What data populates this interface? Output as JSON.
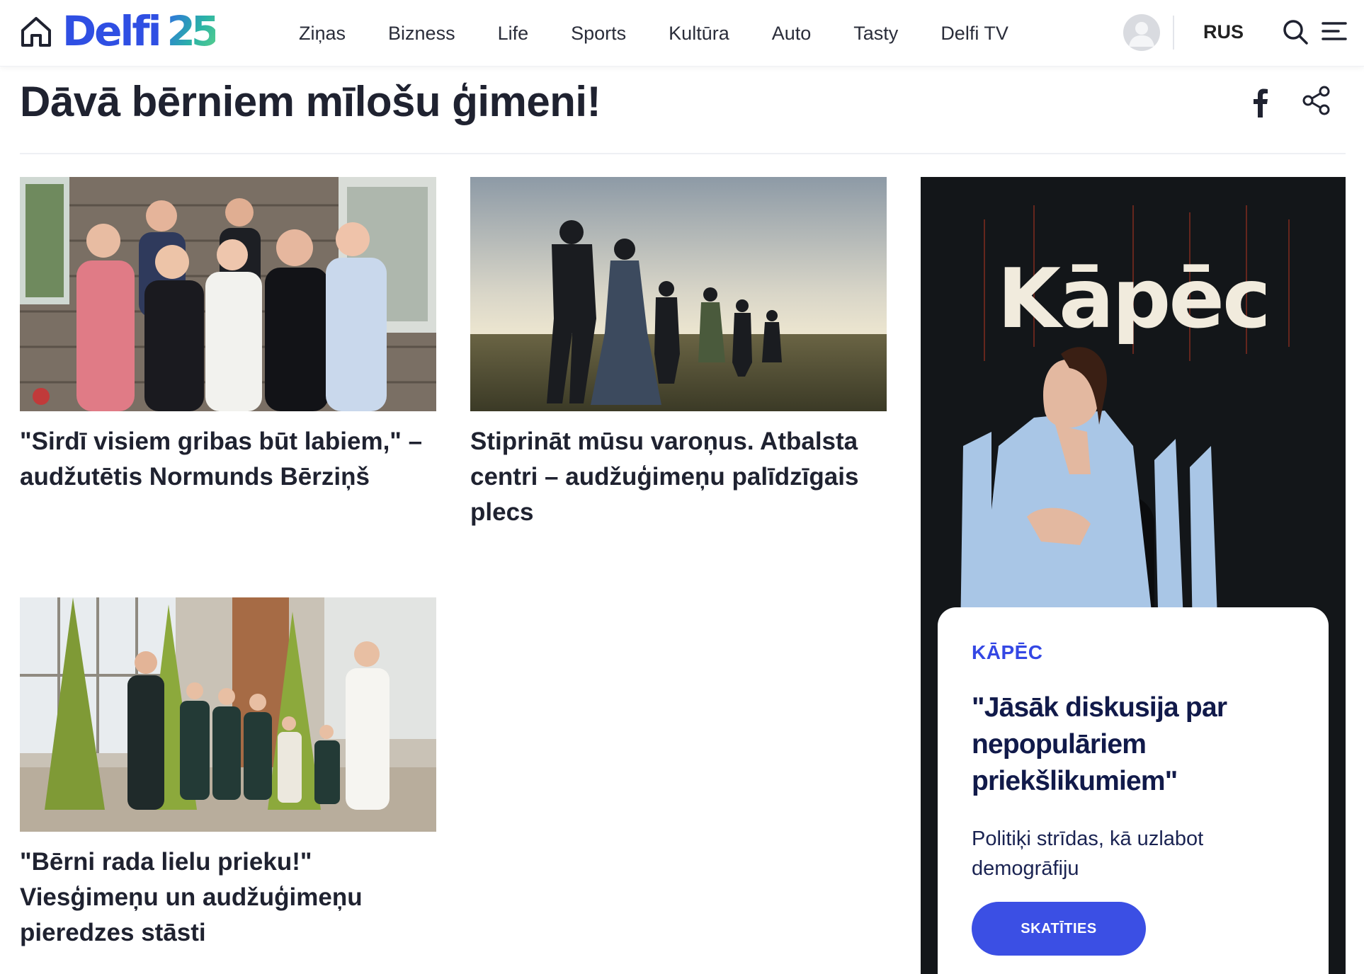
{
  "header": {
    "logo_text": "Delfi",
    "logo_number": "25",
    "nav": [
      "Ziņas",
      "Bizness",
      "Life",
      "Sports",
      "Kultūra",
      "Auto",
      "Tasty",
      "Delfi TV"
    ],
    "language": "RUS"
  },
  "page": {
    "title": "Dāvā bērniem mīlošu ģimeni!"
  },
  "articles": [
    {
      "title": "\"Sirdī visiem gribas būt labiem,\" – audžutētis Normunds Bērziņš"
    },
    {
      "title": "Stiprināt mūsu varoņus. Atbalsta centri – audžuģimeņu palīdzīgais plecs"
    },
    {
      "title": "\"Bērni rada lielu prieku!\" Viesģimeņu un audžuģimeņu pieredzes stāsti"
    }
  ],
  "promo": {
    "art_title": "Kāpēc",
    "kicker": "KĀPĒC",
    "title": "\"Jāsāk diskusija par nepopulāriem priekšlikumiem\"",
    "description": "Politiķi strīdas, kā uzlabot demogrāfiju",
    "button_label": "SKATĪTIES"
  },
  "colors": {
    "brand_blue": "#2f4fe3",
    "button_blue": "#3b4fe4",
    "promo_dark": "#131619",
    "promo_title_navy": "#111a4a"
  }
}
